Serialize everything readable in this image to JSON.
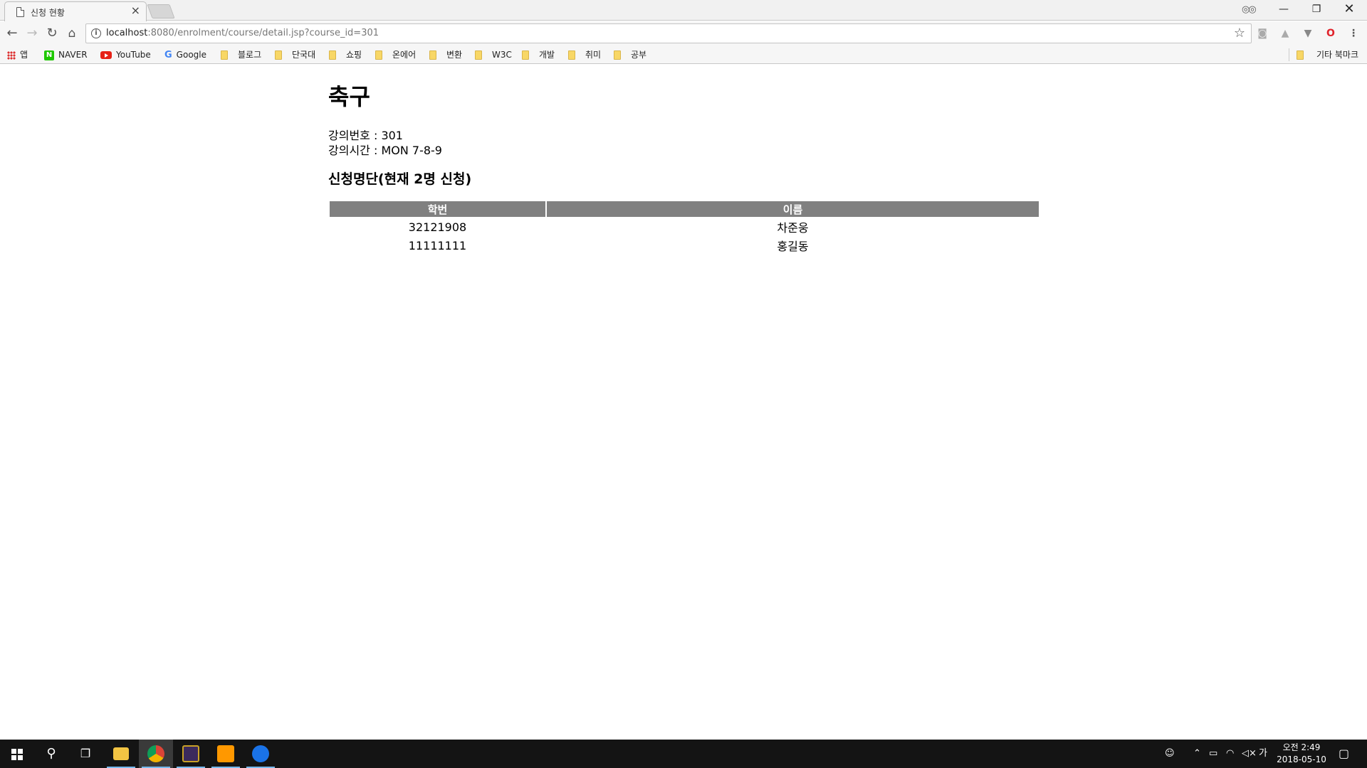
{
  "browser": {
    "tab_title": "신청 현황",
    "tab_close": "×",
    "url_host": "localhost",
    "url_rest": ":8080/enrolment/course/detail.jsp?course_id=301"
  },
  "bookmarks": [
    {
      "label": "앱",
      "icon": "apps-icon"
    },
    {
      "label": "NAVER",
      "icon": "naver-icon"
    },
    {
      "label": "YouTube",
      "icon": "youtube-icon"
    },
    {
      "label": "Google",
      "icon": "google-icon"
    },
    {
      "label": "블로그",
      "icon": "folder-icon"
    },
    {
      "label": "단국대",
      "icon": "folder-icon"
    },
    {
      "label": "쇼핑",
      "icon": "folder-icon"
    },
    {
      "label": "온에어",
      "icon": "folder-icon"
    },
    {
      "label": "변환",
      "icon": "folder-icon"
    },
    {
      "label": "W3C",
      "icon": "folder-icon"
    },
    {
      "label": "개발",
      "icon": "folder-icon"
    },
    {
      "label": "취미",
      "icon": "folder-icon"
    },
    {
      "label": "공부",
      "icon": "folder-icon"
    },
    {
      "label": "기타 북마크",
      "icon": "folder-icon"
    }
  ],
  "page": {
    "title": "축구",
    "course_number": "강의번호 : 301",
    "course_time": "강의시간 : MON 7-8-9",
    "roster_heading": "신청명단(현재 2명 신청)",
    "table": {
      "headers": [
        "학번",
        "이름"
      ],
      "rows": [
        [
          "32121908",
          "차준웅"
        ],
        [
          "11111111",
          "홍길동"
        ]
      ]
    }
  },
  "taskbar": {
    "clock_time": "오전 2:49",
    "clock_date": "2018-05-10",
    "ime": "가"
  },
  "colors": {
    "table_header_bg": "#808080",
    "taskbar_bg": "#141414",
    "accent": "#76b9ed"
  }
}
